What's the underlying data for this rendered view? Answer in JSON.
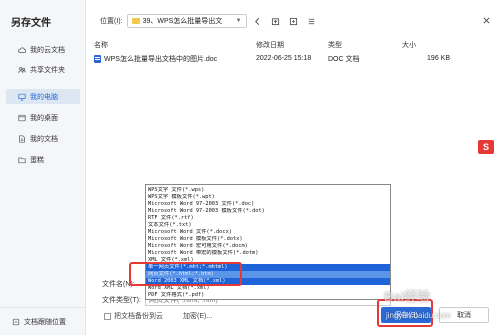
{
  "dialog": {
    "title": "另存文件"
  },
  "sidebar": {
    "items": [
      {
        "label": "我的云文档",
        "icon": "cloud-icon"
      },
      {
        "label": "共享文件夹",
        "icon": "shared-folder-icon"
      },
      {
        "label": "我的电脑",
        "icon": "computer-icon",
        "active": true
      },
      {
        "label": "我的桌面",
        "icon": "desktop-icon"
      },
      {
        "label": "我的文档",
        "icon": "document-icon"
      },
      {
        "label": "蛋糕",
        "icon": "folder-icon"
      }
    ],
    "bottom_label": "文档跟随位置"
  },
  "toolbar": {
    "location_label": "位置(I):",
    "location_value": "39、WPS怎么批量导出文",
    "back_icon": "back-arrow-icon",
    "up_icon": "up-folder-icon",
    "new_folder_icon": "new-folder-icon",
    "view_icon": "view-list-icon"
  },
  "list": {
    "headers": {
      "name": "名称",
      "date": "修改日期",
      "type": "类型",
      "size": "大小"
    },
    "rows": [
      {
        "name": "WPS怎么批量导出文档中的图片.doc",
        "date": "2022-06-25 15:18",
        "type": "DOC 文档",
        "size": "196 KB"
      }
    ]
  },
  "dropdown": {
    "options": [
      "WPS文字 文件(*.wps)",
      "WPS文字 模板文件(*.wpt)",
      "Microsoft Word 97-2003 文件(*.doc)",
      "Microsoft Word 97-2003 模板文件(*.dot)",
      "RTF 文件(*.rtf)",
      "文本文件(*.txt)",
      "Microsoft Word 文件(*.docx)",
      "Microsoft Word 模板文件(*.dotx)",
      "Microsoft Word 宏可用文件(*.docm)",
      "Microsoft Word 带宏的模板文件(*.dotm)",
      "XML 文件(*.xml)",
      "单一网页文件(*.mht;*.mhtml)",
      "网页文件(*.html;*.htm)",
      "Word 2003 XML 文档(*.xml)",
      "Word XML 文档(*.xml)",
      "PDF 文件格式(*.pdf)"
    ],
    "selected_index": 12,
    "hover_index": 11
  },
  "form": {
    "filename_label": "文件名(N):",
    "filetype_label": "文件类型(T):",
    "filetype_value": "网页文件(*.html;*.htm)",
    "backup_label": "把文档备份到云",
    "encrypt_label": "加密(E)..."
  },
  "buttons": {
    "save": "保存(S)",
    "cancel": "取消"
  },
  "badge": {
    "text": "S"
  },
  "watermark": {
    "main": "Bai经验",
    "sub": "jingyan.baidu.com"
  },
  "colors": {
    "accent": "#2b6ad6",
    "annotation": "#e53935",
    "sidebar_bg": "#f5f6f8"
  }
}
